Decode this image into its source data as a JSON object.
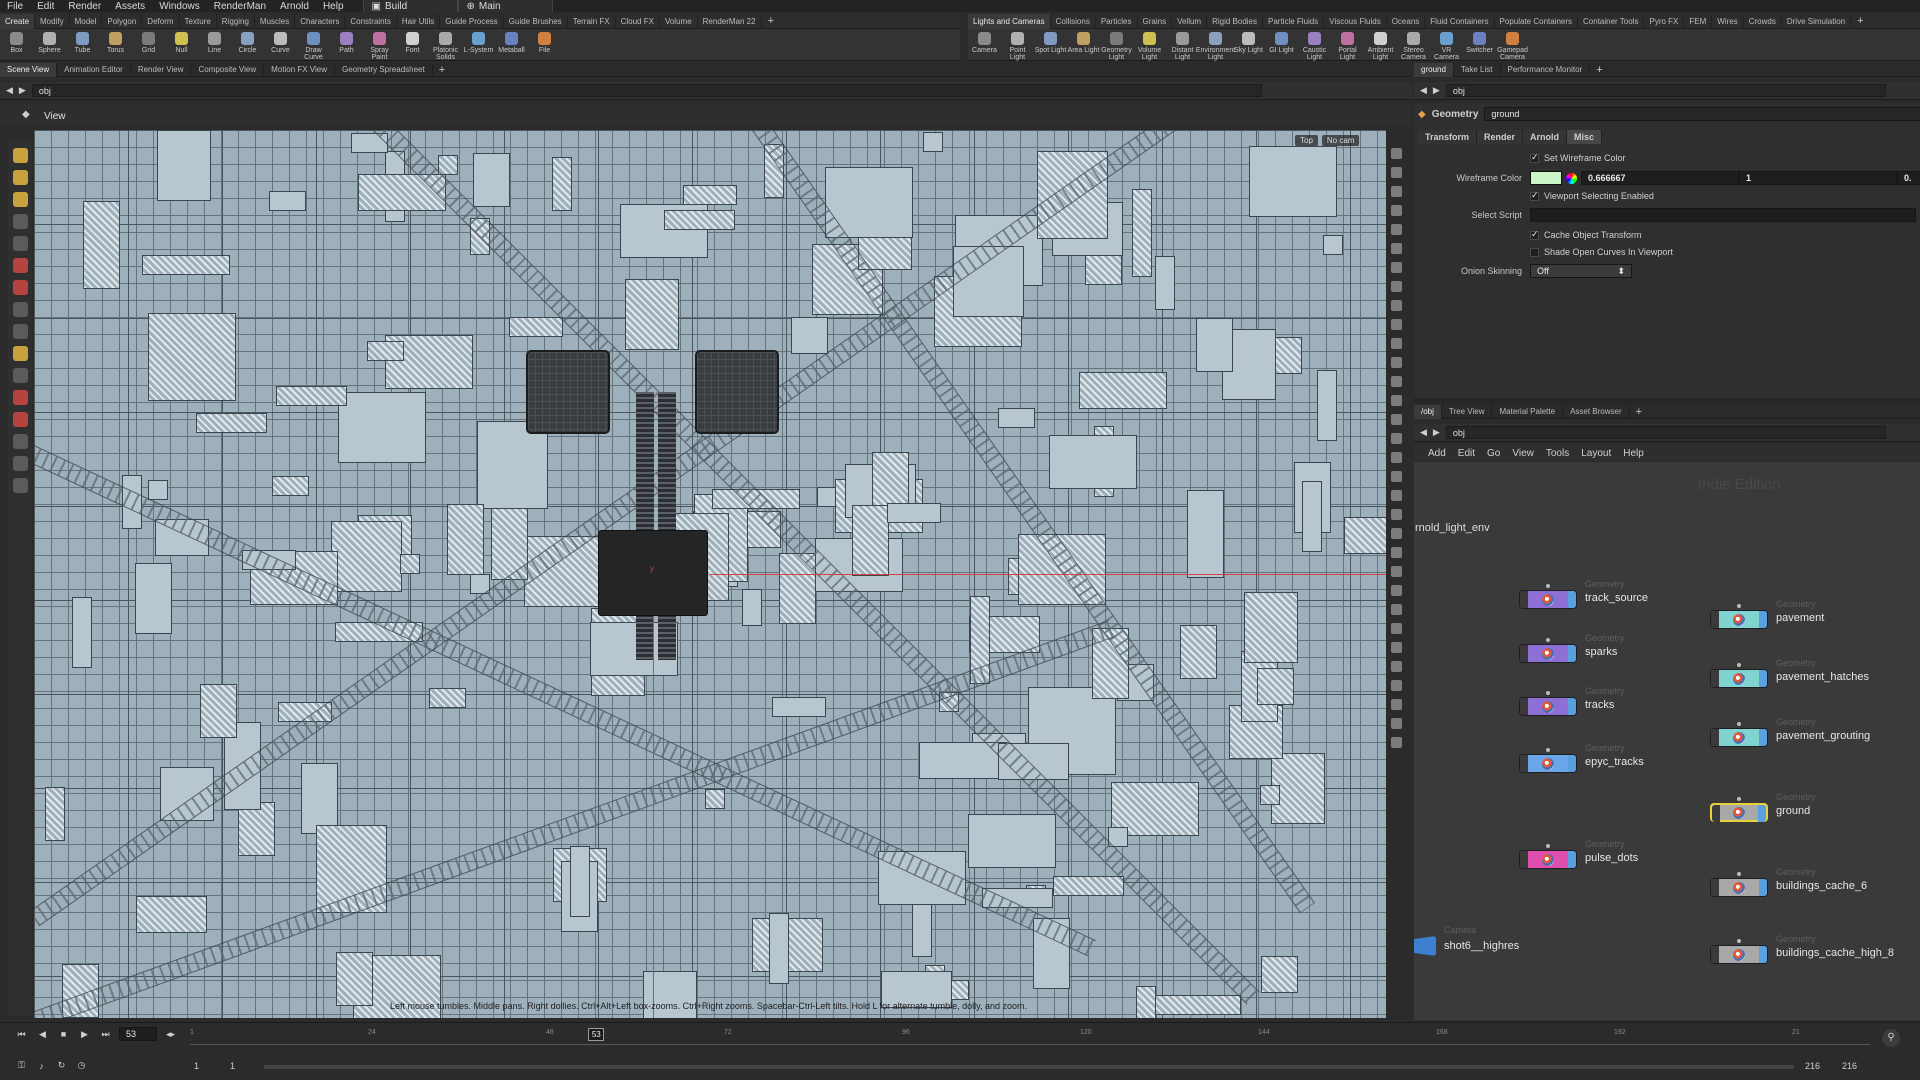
{
  "menubar": {
    "items": [
      "File",
      "Edit",
      "Render",
      "Assets",
      "Windows",
      "RenderMan",
      "Arnold",
      "Help"
    ],
    "desktop": "Build",
    "context": "Main"
  },
  "shelf_left": {
    "tabs": [
      "Create",
      "Modify",
      "Model",
      "Polygon",
      "Deform",
      "Texture",
      "Rigging",
      "Muscles",
      "Characters",
      "Constraints",
      "Hair Utils",
      "Guide Process",
      "Guide Brushes",
      "Terrain FX",
      "Cloud FX",
      "Volume",
      "RenderMan 22"
    ],
    "tools": [
      "Box",
      "Sphere",
      "Tube",
      "Torus",
      "Grid",
      "Null",
      "Line",
      "Circle",
      "Curve",
      "Draw Curve",
      "Path",
      "Spray Paint",
      "Font",
      "Platonic Solids",
      "L-System",
      "Metaball",
      "File"
    ]
  },
  "shelf_right": {
    "tabs": [
      "Lights and Cameras",
      "Collisions",
      "Particles",
      "Grains",
      "Vellum",
      "Rigid Bodies",
      "Particle Fluids",
      "Viscous Fluids",
      "Oceans",
      "Fluid Containers",
      "Populate Containers",
      "Container Tools",
      "Pyro FX",
      "FEM",
      "Wires",
      "Crowds",
      "Drive Simulation"
    ],
    "tools": [
      "Camera",
      "Point Light",
      "Spot Light",
      "Area Light",
      "Geometry Light",
      "Volume Light",
      "Distant Light",
      "Environment Light",
      "Sky Light",
      "GI Light",
      "Caustic Light",
      "Portal Light",
      "Ambient Light",
      "Stereo Camera",
      "VR Camera",
      "Switcher",
      "Gamepad Camera"
    ]
  },
  "viewport_tabs": [
    "Scene View",
    "Animation Editor",
    "Render View",
    "Composite View",
    "Motion FX View",
    "Geometry Spreadsheet"
  ],
  "viewport": {
    "path": "obj",
    "title": "View",
    "camera_view": "Top",
    "camera": "No cam",
    "status": "Left mouse tumbles. Middle pans. Right dollies. Ctrl+Alt+Left box-zooms. Ctrl+Right zooms. Spacebar-Ctrl-Left tilts. Hold L for alternate tumble, dolly, and zoom.",
    "axis_label": "y"
  },
  "param_tabs_bar": [
    "ground",
    "Take List",
    "Performance Monitor"
  ],
  "params": {
    "path": "obj",
    "node_type": "Geometry",
    "node_name": "ground",
    "tabs": [
      "Transform",
      "Render",
      "Arnold",
      "Misc"
    ],
    "active_tab": "Misc",
    "set_wireframe_color": "Set Wireframe Color",
    "wireframe_color_label": "Wireframe Color",
    "wireframe_r": "0.666667",
    "wireframe_g": "1",
    "wireframe_b": "0.",
    "wireframe_swatch": "#ccf5c8",
    "viewport_selecting": "Viewport Selecting Enabled",
    "select_script_label": "Select Script",
    "cache_transform": "Cache Object Transform",
    "shade_open_curves": "Shade Open Curves In Viewport",
    "onion_label": "Onion Skinning",
    "onion_value": "Off"
  },
  "network_tabs": [
    "/obj",
    "Tree View",
    "Material Palette",
    "Asset Browser"
  ],
  "network": {
    "path": "obj",
    "menu": [
      "Add",
      "Edit",
      "Go",
      "View",
      "Tools",
      "Layout",
      "Help"
    ],
    "watermark": "Indie Edition",
    "cut_label": "rnold_light_env",
    "nodes": [
      {
        "type": "Geometry",
        "name": "track_source",
        "color": "#8e6fd6"
      },
      {
        "type": "Geometry",
        "name": "sparks",
        "color": "#8e6fd6"
      },
      {
        "type": "Geometry",
        "name": "tracks",
        "color": "#8e6fd6"
      },
      {
        "type": "Geometry",
        "name": "epyc_tracks",
        "color": "#6aa6e8"
      },
      {
        "type": "Geometry",
        "name": "pulse_dots",
        "color": "#e04fb0"
      },
      {
        "type": "Camera",
        "name": "shot6__highres",
        "color": "#3e7fd0"
      },
      {
        "type": "Geometry",
        "name": "pavement",
        "color": "#7fd3d0"
      },
      {
        "type": "Geometry",
        "name": "pavement_hatches",
        "color": "#7fd3d0"
      },
      {
        "type": "Geometry",
        "name": "pavement_grouting",
        "color": "#7fd3d0"
      },
      {
        "type": "Geometry",
        "name": "ground",
        "color": "#a8a8a8"
      },
      {
        "type": "Geometry",
        "name": "buildings_cache_6",
        "color": "#a8a8a8"
      },
      {
        "type": "Geometry",
        "name": "buildings_cache_high_8",
        "color": "#a8a8a8"
      }
    ]
  },
  "timeline": {
    "current_frame": "53",
    "start_frame": "1",
    "range_start": "1",
    "end_frame": "216",
    "range_end": "216",
    "ticks": [
      "1",
      "24",
      "48",
      "72",
      "96",
      "120",
      "144",
      "168",
      "192",
      "21"
    ],
    "marker": "53"
  }
}
